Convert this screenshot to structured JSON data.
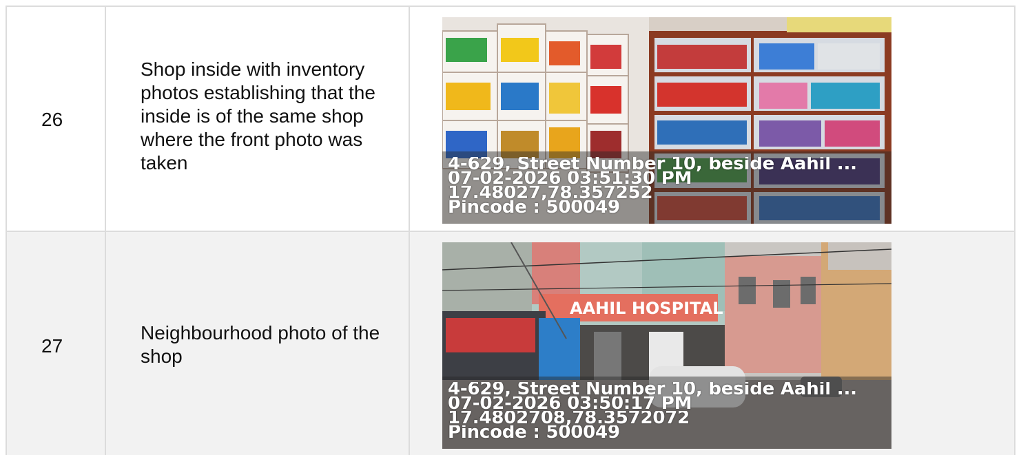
{
  "rows": [
    {
      "number": "26",
      "description": "Shop inside with inventory photos establishing that the inside is of the same shop where the front photo was taken",
      "photo": {
        "icon": "shop-interior-photo",
        "stamp": {
          "address": "4-629, Street Number 10, beside Aahil ...",
          "datetime": "07-02-2026 03:51:30 PM",
          "coords": "17.48027,78.357252",
          "pincode": "Pincode : 500049"
        }
      }
    },
    {
      "number": "27",
      "description": "Neighbourhood photo of the shop",
      "photo": {
        "icon": "street-neighbourhood-photo",
        "sign_text": "AAHIL HOSPITAL",
        "stamp": {
          "address": "4-629, Street Number 10, beside Aahil ...",
          "datetime": "07-02-2026 03:50:17 PM",
          "coords": "17.4802708,78.3572072",
          "pincode": "Pincode : 500049"
        }
      }
    }
  ]
}
